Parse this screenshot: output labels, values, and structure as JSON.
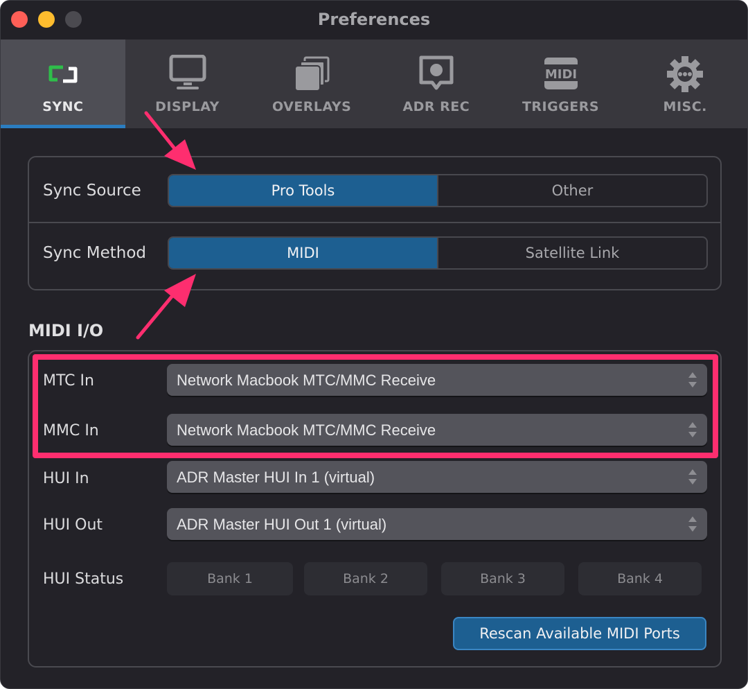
{
  "window": {
    "title": "Preferences",
    "traffic_lights": {
      "close": "#fe5f57",
      "minimize": "#febc2e",
      "maximize": "#4b4a50"
    }
  },
  "tabs": [
    {
      "label": "SYNC",
      "icon": "sync-icon",
      "active": true
    },
    {
      "label": "DISPLAY",
      "icon": "monitor-icon",
      "active": false
    },
    {
      "label": "OVERLAYS",
      "icon": "overlays-icon",
      "active": false
    },
    {
      "label": "ADR REC",
      "icon": "adr-rec-icon",
      "active": false
    },
    {
      "label": "TRIGGERS",
      "icon": "midi-icon",
      "active": false
    },
    {
      "label": "MISC.",
      "icon": "gear-icon",
      "active": false
    }
  ],
  "sync": {
    "source": {
      "label": "Sync Source",
      "options": [
        "Pro Tools",
        "Other"
      ],
      "selected": "Pro Tools"
    },
    "method": {
      "label": "Sync Method",
      "options": [
        "MIDI",
        "Satellite Link"
      ],
      "selected": "MIDI"
    }
  },
  "midi_io": {
    "title": "MIDI I/O",
    "rows": [
      {
        "label": "MTC In",
        "value": "Network Macbook MTC/MMC Receive"
      },
      {
        "label": "MMC In",
        "value": "Network Macbook MTC/MMC Receive"
      },
      {
        "label": "HUI In",
        "value": "ADR Master HUI In 1 (virtual)"
      },
      {
        "label": "HUI Out",
        "value": "ADR Master HUI Out 1 (virtual)"
      }
    ],
    "hui_status": {
      "label": "HUI Status",
      "banks": [
        "Bank 1",
        "Bank 2",
        "Bank 3",
        "Bank 4"
      ]
    },
    "rescan_label": "Rescan Available MIDI Ports"
  },
  "colors": {
    "accent": "#1d5f91",
    "active_tab_underline": "#2b7dc0",
    "annotation": "#fe2e6f",
    "sync_icon_green": "#2fbd4a"
  }
}
